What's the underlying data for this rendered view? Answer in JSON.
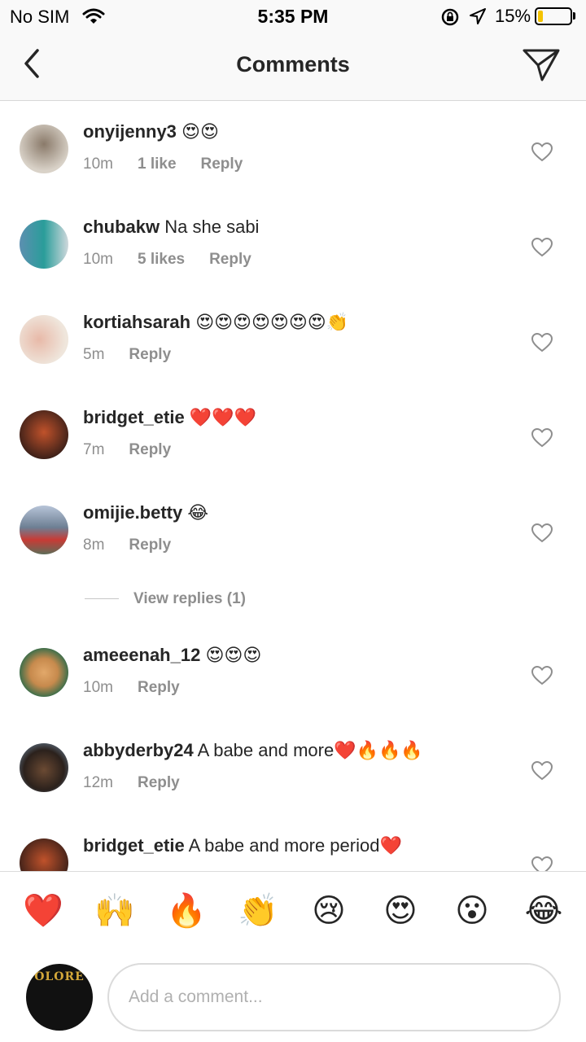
{
  "status": {
    "carrier": "No SIM",
    "time": "5:35 PM",
    "battery": "15%",
    "battery_level": 0.15
  },
  "header": {
    "title": "Comments"
  },
  "comments": [
    {
      "user": "onyijenny3",
      "text": "😍😍",
      "age": "10m",
      "likes": "1 like",
      "reply": "Reply"
    },
    {
      "user": "chubakw",
      "text": "Na she sabi",
      "age": "10m",
      "likes": "5 likes",
      "reply": "Reply"
    },
    {
      "user": "kortiahsarah",
      "text": "😍😍😍😍😍😍😍👏",
      "age": "5m",
      "likes": "",
      "reply": "Reply"
    },
    {
      "user": "bridget_etie",
      "text": "❤️❤️❤️",
      "age": "7m",
      "likes": "",
      "reply": "Reply"
    },
    {
      "user": "omijie.betty",
      "text": "😂",
      "age": "8m",
      "likes": "",
      "reply": "Reply"
    },
    {
      "user": "ameeenah_12",
      "text": "😍😍😍",
      "age": "10m",
      "likes": "",
      "reply": "Reply"
    },
    {
      "user": "abbyderby24",
      "text": "A babe and more❤️🔥🔥🔥",
      "age": "12m",
      "likes": "",
      "reply": "Reply"
    },
    {
      "user": "bridget_etie",
      "text": "A babe and more period❤️",
      "age": "",
      "likes": "",
      "reply": ""
    }
  ],
  "view_replies": "View replies (1)",
  "quick_reactions": [
    "❤️",
    "🙌",
    "🔥",
    "👏",
    "😢",
    "😍",
    "😮",
    "😂"
  ],
  "composer": {
    "placeholder": "Add a comment...",
    "avatar_text": "OLORE"
  },
  "colors": {
    "text": "#262626",
    "meta": "#8e8e8e",
    "border": "#dbdbdb",
    "battery": "#f4c300"
  }
}
